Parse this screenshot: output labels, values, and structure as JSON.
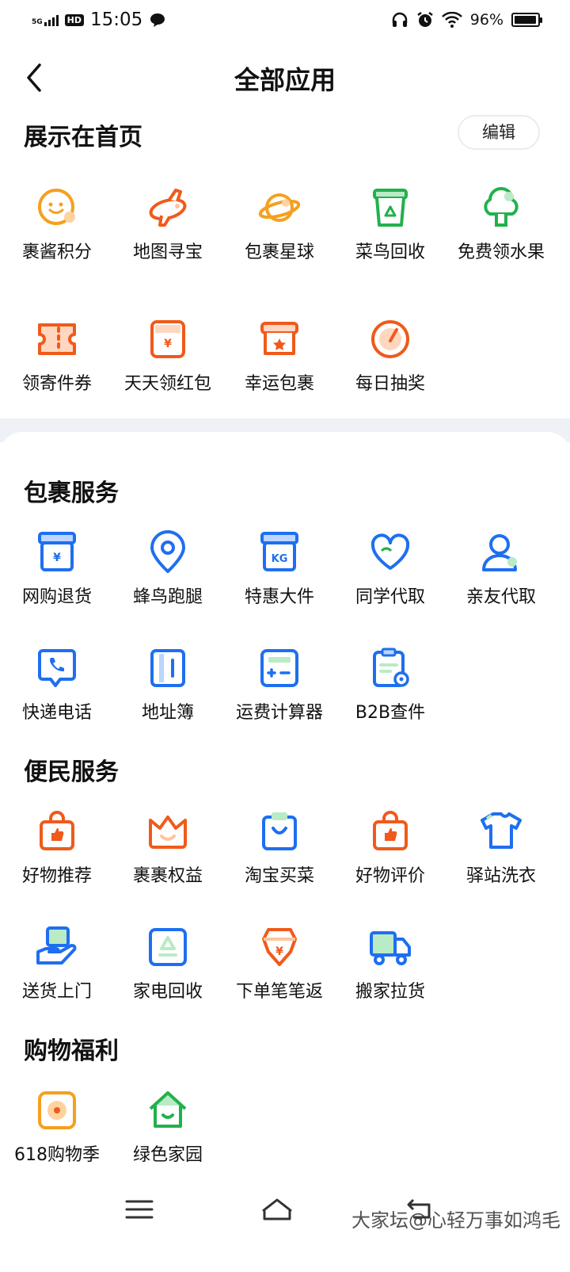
{
  "status": {
    "network": "5G",
    "hd": "HD",
    "time": "15:05",
    "battery": "96%",
    "battery_level": 0.96
  },
  "nav": {
    "title": "全部应用",
    "edit_label": "编辑"
  },
  "sections": {
    "home": {
      "title": "展示在首页",
      "items": [
        {
          "label": "裹酱积分",
          "icon": "smiley-icon"
        },
        {
          "label": "地图寻宝",
          "icon": "plane-icon"
        },
        {
          "label": "包裹星球",
          "icon": "planet-icon"
        },
        {
          "label": "菜鸟回收",
          "icon": "recycle-box-icon"
        },
        {
          "label": "免费领水果",
          "icon": "tree-icon"
        },
        {
          "label": "领寄件券",
          "icon": "ticket-icon"
        },
        {
          "label": "天天领红包",
          "icon": "red-packet-icon"
        },
        {
          "label": "幸运包裹",
          "icon": "lucky-box-icon"
        },
        {
          "label": "每日抽奖",
          "icon": "spin-wheel-icon"
        }
      ]
    },
    "parcel": {
      "title": "包裹服务",
      "items": [
        {
          "label": "网购退货",
          "icon": "return-box-icon"
        },
        {
          "label": "蜂鸟跑腿",
          "icon": "location-pin-icon"
        },
        {
          "label": "特惠大件",
          "icon": "weight-kg-icon"
        },
        {
          "label": "同学代取",
          "icon": "heart-icon"
        },
        {
          "label": "亲友代取",
          "icon": "person-icon"
        },
        {
          "label": "快递电话",
          "icon": "phone-chat-icon"
        },
        {
          "label": "地址簿",
          "icon": "address-book-icon"
        },
        {
          "label": "运费计算器",
          "icon": "calculator-icon"
        },
        {
          "label": "B2B查件",
          "icon": "clipboard-location-icon"
        }
      ]
    },
    "convenience": {
      "title": "便民服务",
      "items": [
        {
          "label": "好物推荐",
          "icon": "shopping-bag-like-icon"
        },
        {
          "label": "裹裹权益",
          "icon": "crown-icon"
        },
        {
          "label": "淘宝买菜",
          "icon": "grocery-bag-icon"
        },
        {
          "label": "好物评价",
          "icon": "shopping-bag-review-icon"
        },
        {
          "label": "驿站洗衣",
          "icon": "tshirt-icon"
        },
        {
          "label": "送货上门",
          "icon": "hand-parcel-icon"
        },
        {
          "label": "家电回收",
          "icon": "recycle-icon"
        },
        {
          "label": "下单笔笔返",
          "icon": "yen-badge-icon"
        },
        {
          "label": "搬家拉货",
          "icon": "truck-icon"
        }
      ]
    },
    "shopping": {
      "title": "购物福利",
      "items": [
        {
          "label": "618购物季",
          "icon": "sale-618-icon"
        },
        {
          "label": "绿色家园",
          "icon": "green-house-icon"
        }
      ]
    }
  },
  "watermark": "大家坛@心轻万事如鸿毛",
  "colors": {
    "orange": "#f05a1a",
    "amber": "#f5a020",
    "blue": "#1e6ff0",
    "green": "#22b14c",
    "band": "#eef1f5"
  }
}
